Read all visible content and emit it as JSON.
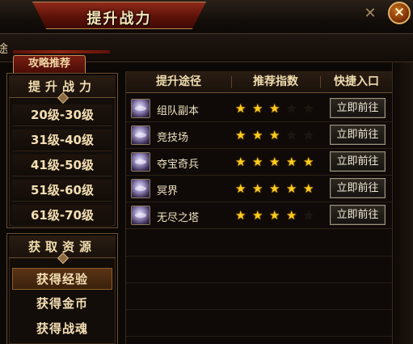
{
  "window": {
    "title": "提升战力",
    "partial_char": "途",
    "close_label": "×",
    "ornament": "✕"
  },
  "tab": {
    "label": "攻略推荐"
  },
  "power_panel": {
    "title": "提升战力",
    "levels": [
      "20级-30级",
      "31级-40级",
      "41级-50级",
      "51级-60级",
      "61级-70级"
    ]
  },
  "resource_panel": {
    "title": "获取资源",
    "items": [
      "获得经验",
      "获得金币",
      "获得战魂"
    ],
    "active_index": 0
  },
  "table": {
    "headers": [
      "提升途径",
      "推荐指数",
      "快捷入口"
    ],
    "rows": [
      {
        "name": "组队副本",
        "stars": 3,
        "button": "立即前往"
      },
      {
        "name": "竞技场",
        "stars": 3,
        "button": "立即前往"
      },
      {
        "name": "夺宝奇兵",
        "stars": 5,
        "button": "立即前往"
      },
      {
        "name": "冥界",
        "stars": 5,
        "button": "立即前往"
      },
      {
        "name": "无尽之塔",
        "stars": 4,
        "button": "立即前往"
      }
    ],
    "max_stars": 5
  },
  "colors": {
    "star_on": "#ffcc1e",
    "star_off": "#1c1410",
    "title_red": "#5d1208",
    "gold_text": "#f0dcae"
  }
}
